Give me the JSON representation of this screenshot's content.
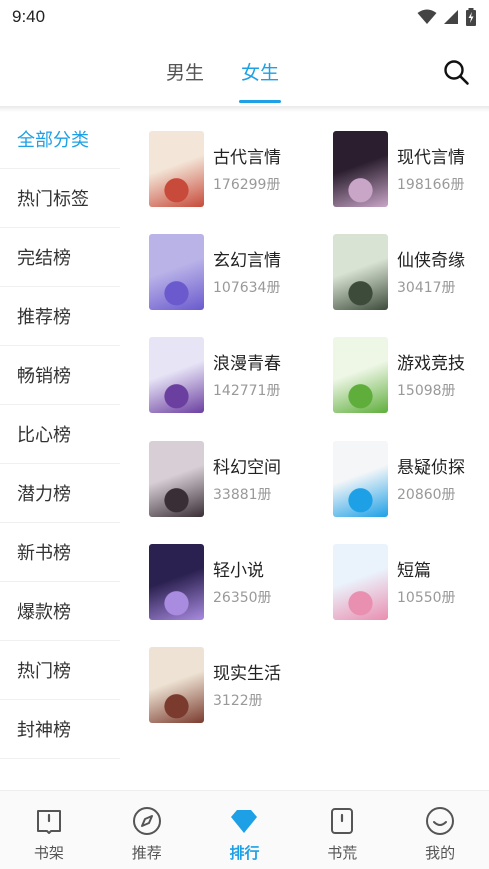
{
  "status": {
    "time": "9:40"
  },
  "header": {
    "tabs": [
      {
        "label": "男生",
        "active": false
      },
      {
        "label": "女生",
        "active": true
      }
    ],
    "accent": "#1ea0e6"
  },
  "sidebar": {
    "items": [
      {
        "label": "全部分类",
        "active": true
      },
      {
        "label": "热门标签",
        "active": false
      },
      {
        "label": "完结榜",
        "active": false
      },
      {
        "label": "推荐榜",
        "active": false
      },
      {
        "label": "畅销榜",
        "active": false
      },
      {
        "label": "比心榜",
        "active": false
      },
      {
        "label": "潜力榜",
        "active": false
      },
      {
        "label": "新书榜",
        "active": false
      },
      {
        "label": "爆款榜",
        "active": false
      },
      {
        "label": "热门榜",
        "active": false
      },
      {
        "label": "封神榜",
        "active": false
      }
    ]
  },
  "categories": [
    {
      "name": "古代言情",
      "count": "176299册",
      "cover_colors": [
        "#f3e6d8",
        "#c74a3a"
      ]
    },
    {
      "name": "现代言情",
      "count": "198166册",
      "cover_colors": [
        "#2b1f2f",
        "#c9a6c8"
      ]
    },
    {
      "name": "玄幻言情",
      "count": "107634册",
      "cover_colors": [
        "#b9b3e8",
        "#6a5acd"
      ]
    },
    {
      "name": "仙侠奇缘",
      "count": "30417册",
      "cover_colors": [
        "#d9e3d4",
        "#3d4c3a"
      ]
    },
    {
      "name": "浪漫青春",
      "count": "142771册",
      "cover_colors": [
        "#e7e4f6",
        "#6b3fa0"
      ]
    },
    {
      "name": "游戏竞技",
      "count": "15098册",
      "cover_colors": [
        "#eef6e6",
        "#5fae3c"
      ]
    },
    {
      "name": "科幻空间",
      "count": "33881册",
      "cover_colors": [
        "#d8cfd6",
        "#3a2e36"
      ]
    },
    {
      "name": "悬疑侦探",
      "count": "20860册",
      "cover_colors": [
        "#f4f6f8",
        "#1ea0e6"
      ]
    },
    {
      "name": "轻小说",
      "count": "26350册",
      "cover_colors": [
        "#2b2150",
        "#a98be0"
      ]
    },
    {
      "name": "短篇",
      "count": "10550册",
      "cover_colors": [
        "#eaf2fb",
        "#e98fb0"
      ]
    },
    {
      "name": "现实生活",
      "count": "3122册",
      "cover_colors": [
        "#ede2d3",
        "#7a3b2e"
      ]
    }
  ],
  "bottom_nav": [
    {
      "label": "书架",
      "icon": "book-icon",
      "active": false
    },
    {
      "label": "推荐",
      "icon": "compass-icon",
      "active": false
    },
    {
      "label": "排行",
      "icon": "diamond-icon",
      "active": true
    },
    {
      "label": "书荒",
      "icon": "card-icon",
      "active": false
    },
    {
      "label": "我的",
      "icon": "smile-icon",
      "active": false
    }
  ]
}
